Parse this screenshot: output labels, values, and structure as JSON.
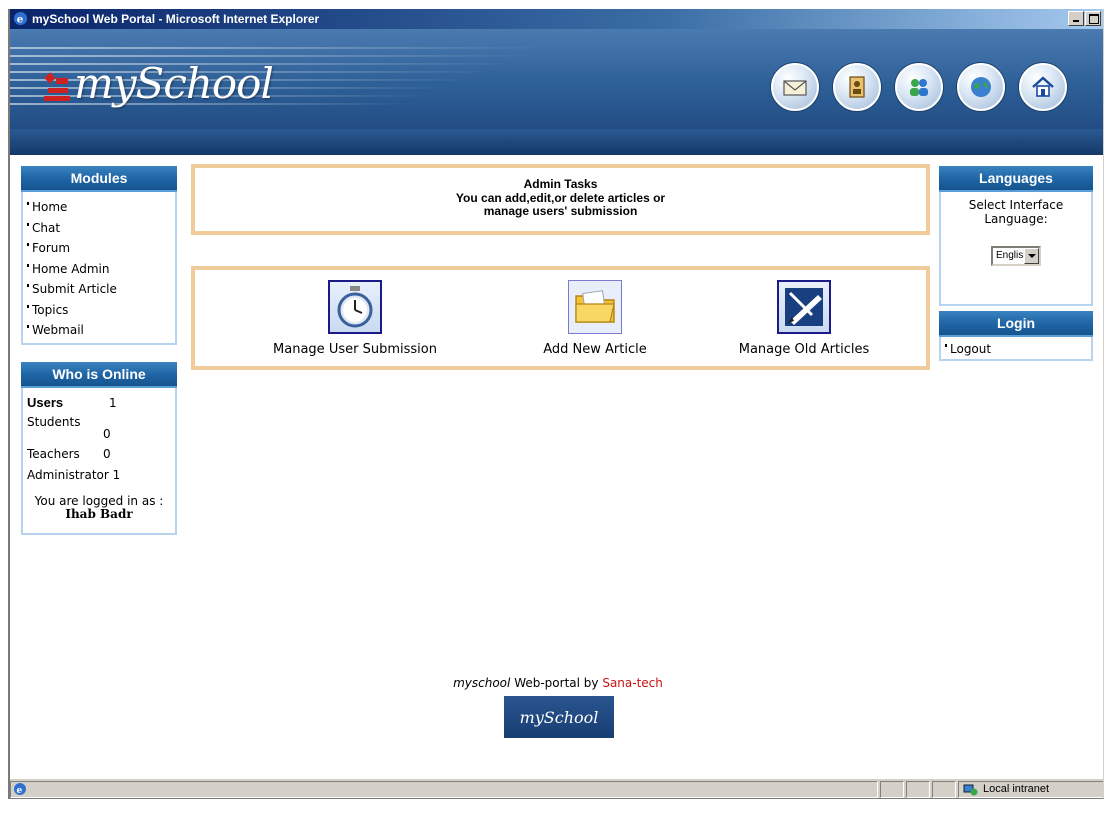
{
  "window": {
    "title": "mySchool Web Portal - Microsoft Internet Explorer"
  },
  "banner": {
    "logo_text": "mySchool",
    "icons": [
      "mail-icon",
      "user-card-icon",
      "users-group-icon",
      "globe-icon",
      "home-icon"
    ]
  },
  "modules": {
    "title": "Modules",
    "items": [
      "Home",
      "Chat",
      "Forum",
      "Home Admin",
      "Submit Article",
      "Topics",
      "Webmail"
    ]
  },
  "online": {
    "title": "Who is Online",
    "rows": [
      {
        "label": "Users",
        "value": "1"
      },
      {
        "label": "Students",
        "value": "0"
      },
      {
        "label": "Teachers",
        "value": "0"
      },
      {
        "label": "Administrator",
        "value": "1"
      }
    ],
    "logged_in_label": "You are logged in as :",
    "logged_in_name": "Ihab Badr"
  },
  "admin": {
    "title": "Admin Tasks",
    "line1": "You can add,edit,or delete articles or",
    "line2": "manage users' submission"
  },
  "tasks": [
    {
      "label": "Manage User Submission",
      "icon": "stopwatch-icon"
    },
    {
      "label": "Add New Article",
      "icon": "folder-icon"
    },
    {
      "label": "Manage Old Articles",
      "icon": "pen-paper-icon"
    }
  ],
  "languages": {
    "title": "Languages",
    "prompt_line1": "Select Interface",
    "prompt_line2": "Language:",
    "selected": "English"
  },
  "login": {
    "title": "Login",
    "items": [
      "Logout"
    ]
  },
  "footer": {
    "brand": "myschool",
    "by_text": "Web-portal by",
    "company": "Sana-tech",
    "logo_text": "mySchool"
  },
  "statusbar": {
    "zone": "Local intranet"
  },
  "colors": {
    "banner": "#2d5f97",
    "panel_header": "#1e64a4",
    "box_border": "#f0cc9a",
    "company_link": "#cc1111"
  }
}
